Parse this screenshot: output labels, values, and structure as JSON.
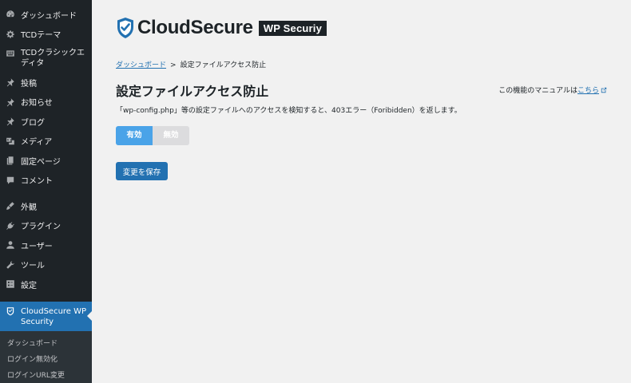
{
  "sidebar": {
    "items": [
      {
        "label": "ダッシュボード",
        "icon": "dashboard-icon"
      },
      {
        "label": "TCDテーマ",
        "icon": "gear-icon"
      },
      {
        "label": "TCDクラシックエディタ",
        "icon": "keyboard-icon"
      },
      {
        "label": "投稿",
        "icon": "pin-icon"
      },
      {
        "label": "お知らせ",
        "icon": "pin-icon"
      },
      {
        "label": "ブログ",
        "icon": "pin-icon"
      },
      {
        "label": "メディア",
        "icon": "media-icon"
      },
      {
        "label": "固定ページ",
        "icon": "pages-icon"
      },
      {
        "label": "コメント",
        "icon": "comment-icon"
      },
      {
        "label": "外観",
        "icon": "appearance-icon"
      },
      {
        "label": "プラグイン",
        "icon": "plugin-icon"
      },
      {
        "label": "ユーザー",
        "icon": "user-icon"
      },
      {
        "label": "ツール",
        "icon": "wrench-icon"
      },
      {
        "label": "設定",
        "icon": "settings-icon"
      }
    ],
    "active": {
      "label": "CloudSecure WP Security",
      "icon": "cloudsecure-icon"
    },
    "submenu": [
      "ダッシュボード",
      "ログイン無効化",
      "ログインURL変更"
    ]
  },
  "logo": {
    "brand": "CloudSecure",
    "badge": "WP Securiy"
  },
  "breadcrumb": {
    "link": "ダッシュボード",
    "separator": ">",
    "current": "設定ファイルアクセス防止"
  },
  "page": {
    "title": "設定ファイルアクセス防止",
    "manual_prefix": "この機能のマニュアルは",
    "manual_link": "こちら",
    "description": "「wp-config.php」等の設定ファイルへのアクセスを検知すると、403エラー（Foribidden）を返します。"
  },
  "toggle": {
    "on_label": "有効",
    "off_label": "無効",
    "selected": "有効"
  },
  "save_label": "変更を保存",
  "colors": {
    "sidebar_bg": "#1e2327",
    "accent": "#2271b1",
    "toggle_on": "#4aa3e8"
  }
}
